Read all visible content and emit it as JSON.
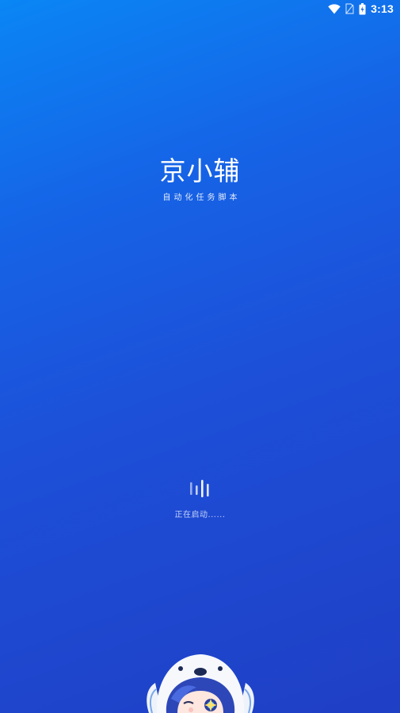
{
  "status_bar": {
    "time": "3:13",
    "icons": [
      "wifi-icon",
      "no-sim-icon",
      "battery-icon"
    ]
  },
  "app": {
    "title": "京小辅",
    "subtitle": "自动化任务脚本"
  },
  "loading": {
    "text": "正在启动......"
  },
  "colors": {
    "gradient_top": "#0a86f5",
    "gradient_bottom": "#1f3fc5",
    "text": "#ffffff"
  },
  "mascot": {
    "icon": "mascot-character-image"
  }
}
